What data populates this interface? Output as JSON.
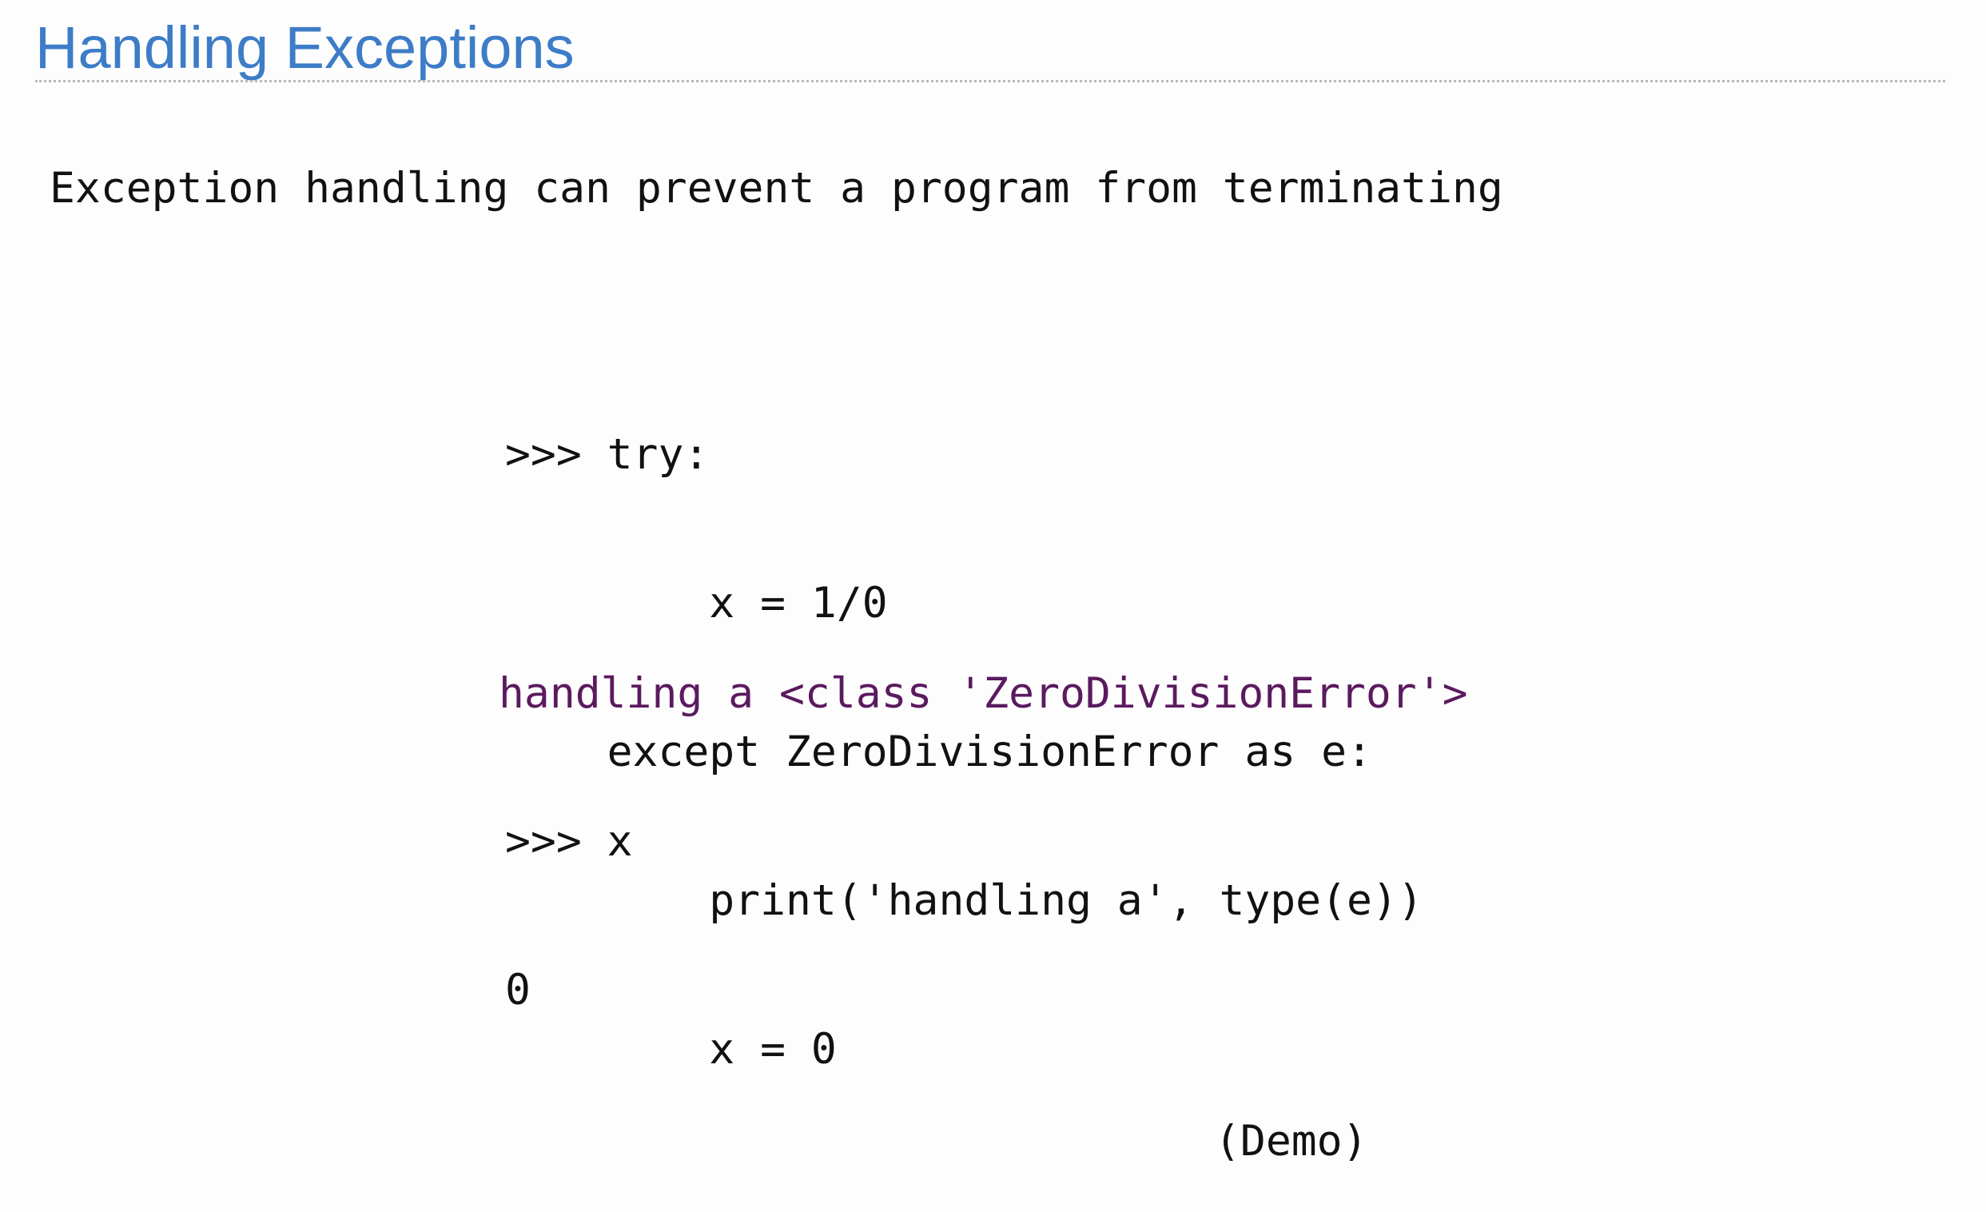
{
  "slide": {
    "title": "Handling Exceptions",
    "subtitle": "Exception handling can prevent a program from terminating",
    "code_lines": [
      ">>> try:",
      "        x = 1/0",
      "    except ZeroDivisionError as e:",
      "        print('handling a', type(e))",
      "        x = 0"
    ],
    "output_line": "handling a <class 'ZeroDivisionError'>",
    "repl_lines": [
      ">>> x",
      "0"
    ],
    "demo_label": "(Demo)"
  },
  "colors": {
    "title": "#3d7cc7",
    "text": "#111111",
    "output": "#5b1a5f",
    "rule": "#b8b8b8"
  }
}
